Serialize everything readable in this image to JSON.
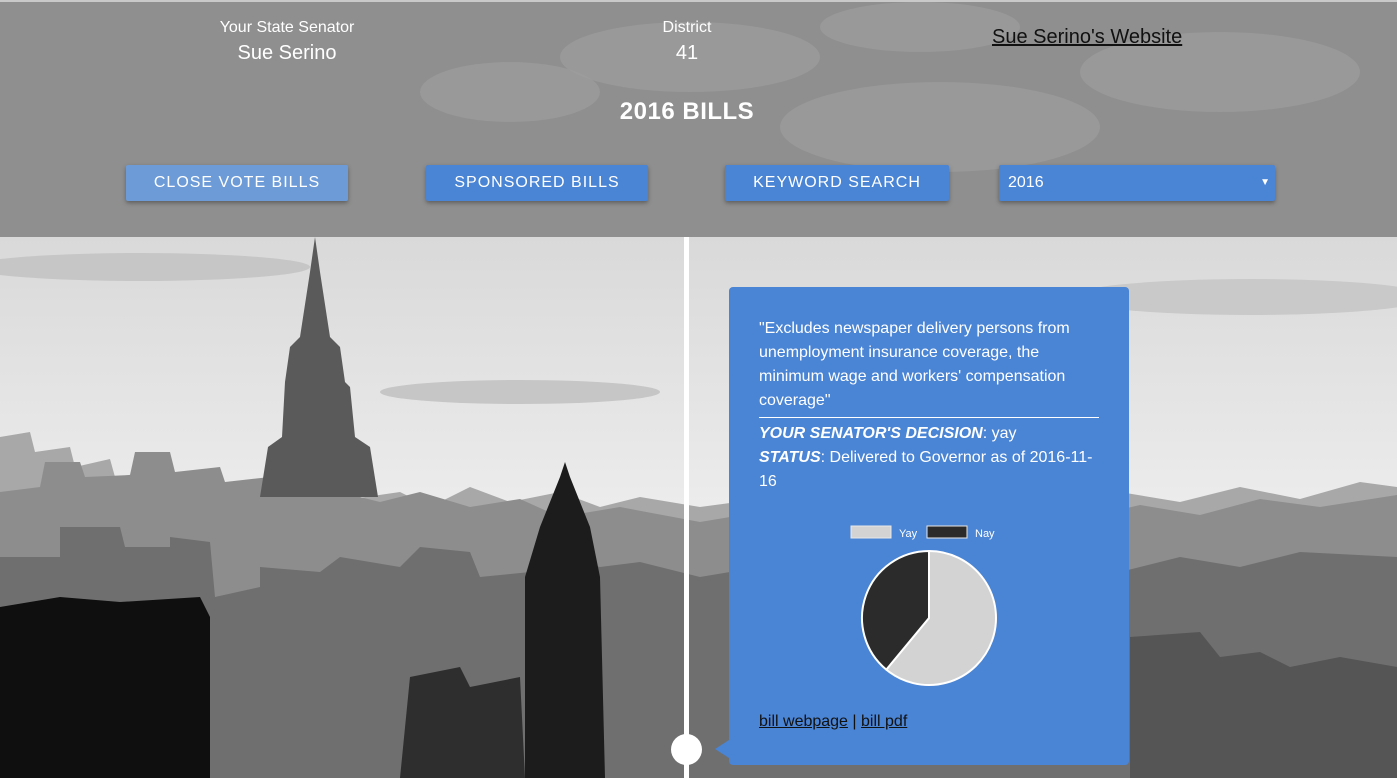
{
  "header": {
    "senator_label": "Your State Senator",
    "senator_name": "Sue Serino",
    "district_label": "District",
    "district_number": "41",
    "website_link": "Sue Serino's Website",
    "title": "2016 BILLS"
  },
  "nav": {
    "close_vote": "CLOSE VOTE BILLS",
    "sponsored": "SPONSORED BILLS",
    "keyword": "KEYWORD SEARCH",
    "year_selected": "2016"
  },
  "bill": {
    "description": "\"Excludes newspaper delivery persons from unemployment insurance coverage, the minimum wage and workers' compensation coverage\"",
    "decision_label": "YOUR SENATOR'S DECISION",
    "decision_value": ": yay",
    "status_label": "STATUS",
    "status_value": ": Delivered to Governor as of 2016-11-16",
    "links": {
      "webpage": "bill webpage",
      "separator": "|",
      "pdf": "bill pdf"
    }
  },
  "colors": {
    "accent": "#4a84d4",
    "yay": "#d3d3d3",
    "nay": "#2b2b2b"
  },
  "chart_data": {
    "type": "pie",
    "categories": [
      "Yay",
      "Nay"
    ],
    "values": [
      61,
      39
    ],
    "colors": [
      "#d3d3d3",
      "#2b2b2b"
    ],
    "legend": "top"
  }
}
